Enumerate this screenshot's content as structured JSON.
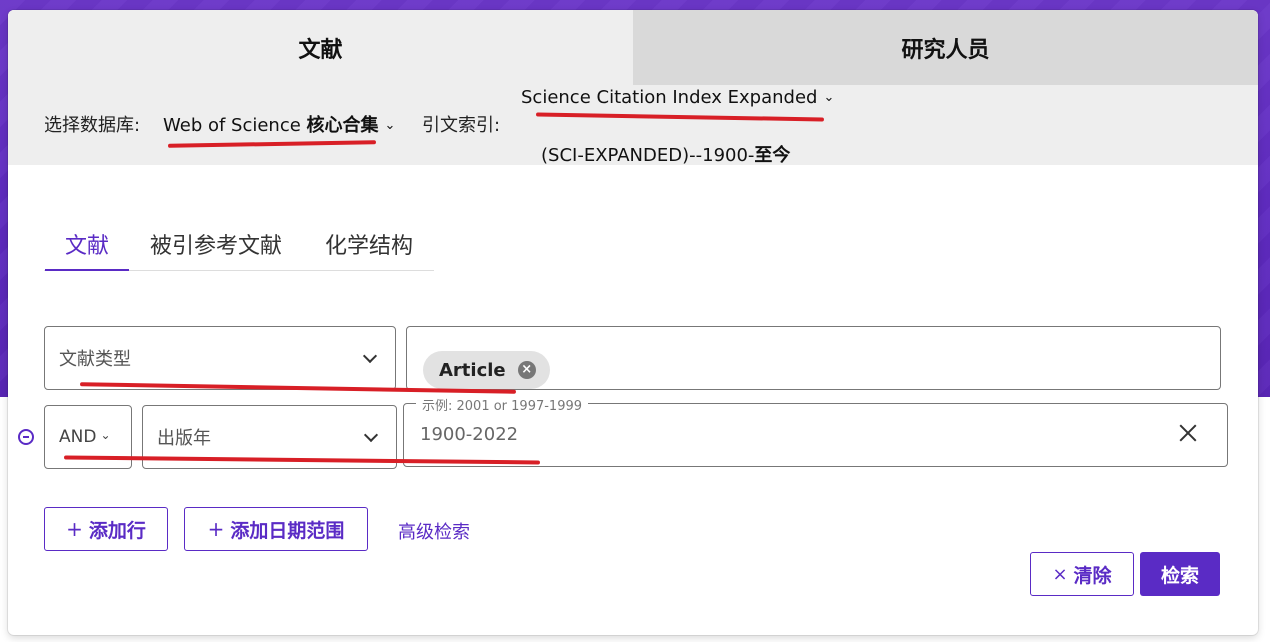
{
  "top_tabs": [
    {
      "label": "文献"
    },
    {
      "label": "研究人员"
    }
  ],
  "database": {
    "label": "选择数据库:",
    "value_regular": "Web of Science ",
    "value_bold": "核心合集",
    "citation_label": "引文索引:",
    "citation_value_line1": "Science Citation Index Expanded",
    "citation_value_line2_regular": "(SCI-EXPANDED)--1900-",
    "citation_value_line2_bold": "至今"
  },
  "sub_tabs": [
    {
      "label": "文献"
    },
    {
      "label": "被引参考文献"
    },
    {
      "label": "化学结构"
    }
  ],
  "rows": [
    {
      "field": "文献类型",
      "chip": "Article"
    },
    {
      "operator": "AND",
      "field": "出版年",
      "hint": "示例: 2001 or 1997-1999",
      "value": "1900-2022"
    }
  ],
  "actions": {
    "add_row": "添加行",
    "add_date_range": "添加日期范围",
    "advanced_search": "高级检索",
    "clear": "清除",
    "search": "检索",
    "plus_symbol": "+",
    "clear_x_symbol": "×"
  },
  "icons": {
    "chevron_down": "chevron-down-icon",
    "remove_row": "minus-circle-icon",
    "clear": "close-icon"
  },
  "colors": {
    "brand_purple": "#5a2bc5",
    "annotation_red": "#d81f26"
  }
}
